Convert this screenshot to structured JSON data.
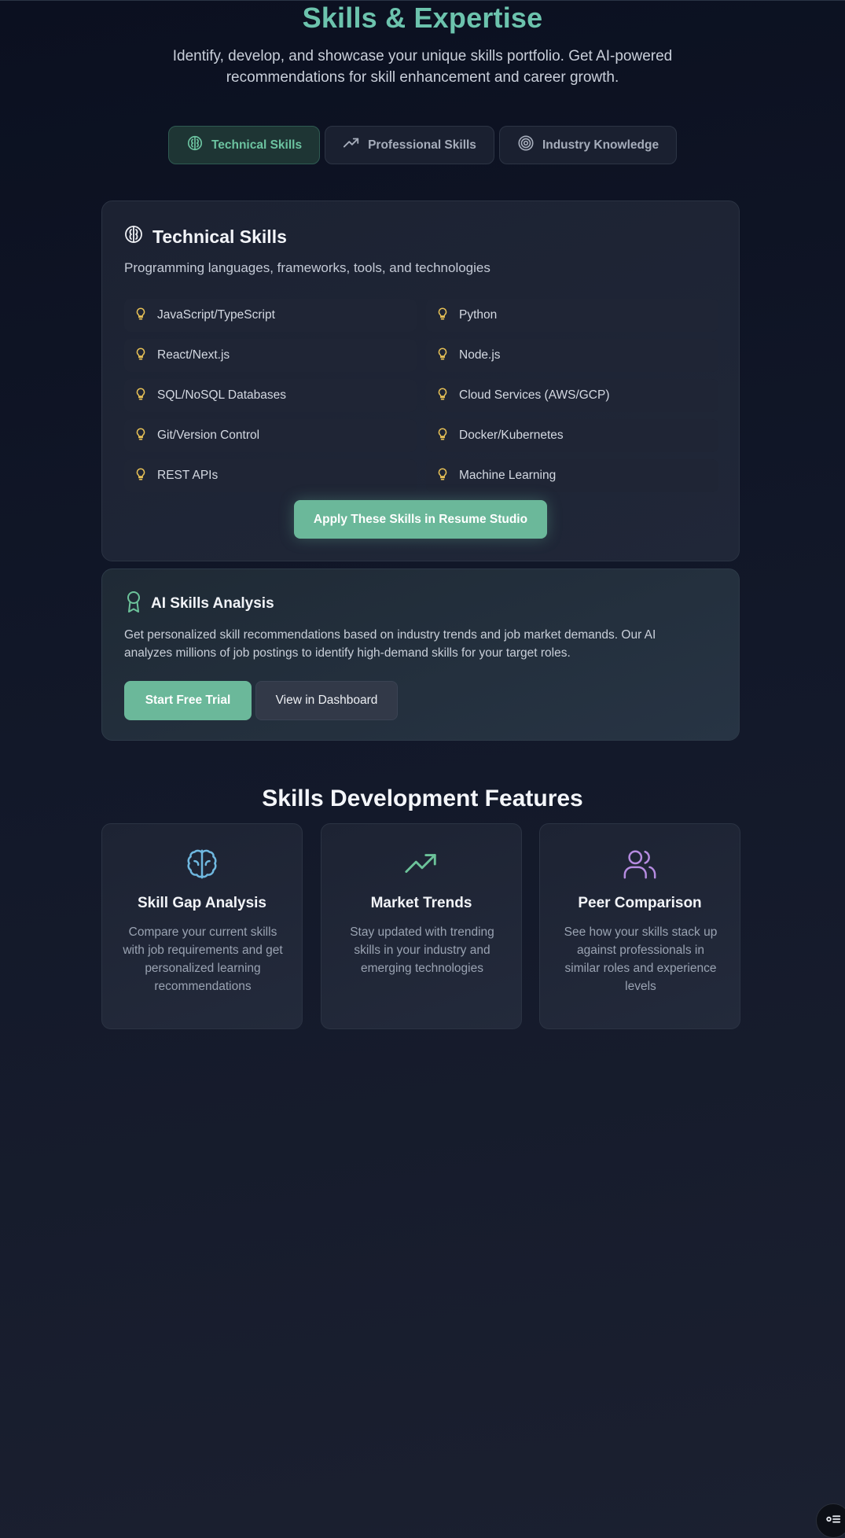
{
  "hero": {
    "title": "Skills & Expertise",
    "subtitle": "Identify, develop, and showcase your unique skills portfolio. Get AI-powered recommendations for skill enhancement and career growth."
  },
  "tabs": [
    {
      "label": "Technical Skills",
      "icon": "brain-icon",
      "active": true
    },
    {
      "label": "Professional Skills",
      "icon": "trending-up-icon",
      "active": false
    },
    {
      "label": "Industry Knowledge",
      "icon": "target-icon",
      "active": false
    }
  ],
  "technical": {
    "title": "Technical Skills",
    "subtitle": "Programming languages, frameworks, tools, and technologies",
    "skills": [
      "JavaScript/TypeScript",
      "Python",
      "React/Next.js",
      "Node.js",
      "SQL/NoSQL Databases",
      "Cloud Services (AWS/GCP)",
      "Git/Version Control",
      "Docker/Kubernetes",
      "REST APIs",
      "Machine Learning"
    ],
    "skill_icon": "lightbulb-icon",
    "apply_label": "Apply These Skills in Resume Studio"
  },
  "ai": {
    "title": "AI Skills Analysis",
    "text": "Get personalized skill recommendations based on industry trends and job market demands. Our AI analyzes millions of job postings to identify high-demand skills for your target roles.",
    "trial_label": "Start Free Trial",
    "dashboard_label": "View in Dashboard"
  },
  "features": {
    "heading": "Skills Development Features",
    "items": [
      {
        "title": "Skill Gap Analysis",
        "desc": "Compare your current skills with job requirements and get personalized learning recommendations",
        "icon": "brain-icon",
        "color": "#6fb8e0"
      },
      {
        "title": "Market Trends",
        "desc": "Stay updated with trending skills in your industry and emerging technologies",
        "icon": "trending-up-icon",
        "color": "#6cc39a"
      },
      {
        "title": "Peer Comparison",
        "desc": "See how your skills stack up against professionals in similar roles and experience levels",
        "icon": "users-icon",
        "color": "#b58be0"
      }
    ]
  },
  "colors": {
    "accent": "#6cc3ad",
    "button_green": "#6bb89a",
    "bulb_yellow": "#e9c256"
  }
}
